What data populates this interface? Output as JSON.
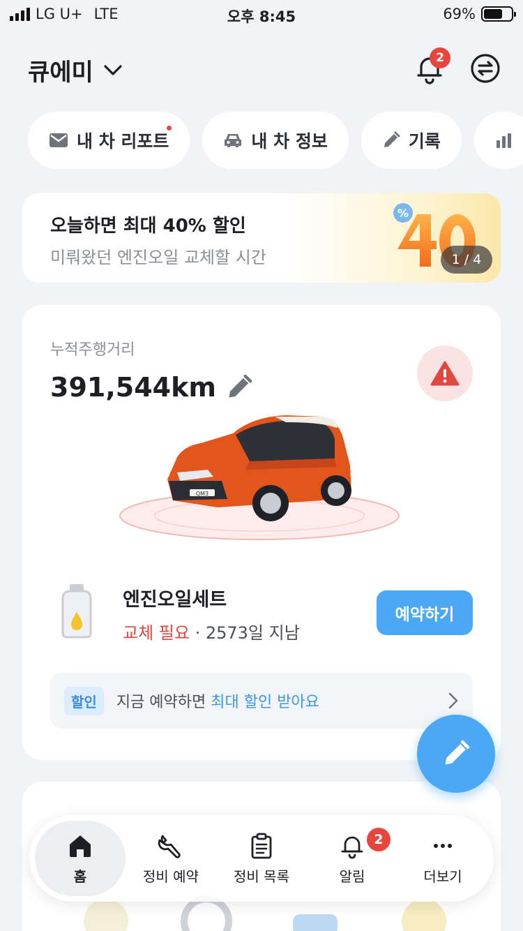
{
  "status_bar": {
    "carrier": "LG U+",
    "network": "LTE",
    "time": "오후 8:45",
    "battery": "69%",
    "battery_level": 0.69
  },
  "header": {
    "car_name": "큐에미",
    "notification_count": "2"
  },
  "chips": [
    {
      "label": "내 차 리포트",
      "icon": "mail-icon",
      "has_dot": true
    },
    {
      "label": "내 차 정보",
      "icon": "car-icon"
    },
    {
      "label": "기록",
      "icon": "pencil-icon"
    },
    {
      "label": "",
      "icon": "bar-chart-icon"
    }
  ],
  "banner": {
    "title": "오늘하면 최대 40% 할인",
    "subtitle": "미뤄왔던 엔진오일 교체할 시간",
    "pager": "1 / 4"
  },
  "vehicle": {
    "odometer_label": "누적주행거리",
    "odometer_value": "391,544km",
    "plate_text": "QM3"
  },
  "maintenance": {
    "item_title": "엔진오일세트",
    "status_need": "교체 필요",
    "status_sep": " · ",
    "status_elapsed": "2573일 지남",
    "reserve_label": "예약하기"
  },
  "discount": {
    "tag": "할인",
    "text_prefix": "지금 예약하면 ",
    "text_highlight": "최대 할인 받아요"
  },
  "tabbar": {
    "items": [
      {
        "label": "홈",
        "icon": "home-icon",
        "active": true
      },
      {
        "label": "정비 예약",
        "icon": "wrench-icon"
      },
      {
        "label": "정비 목록",
        "icon": "clipboard-icon"
      },
      {
        "label": "알림",
        "icon": "bell-icon",
        "badge": "2"
      },
      {
        "label": "더보기",
        "icon": "more-icon"
      }
    ]
  },
  "colors": {
    "accent": "#4aa8f7",
    "alert": "#e8453c",
    "background": "#f2f3f6"
  }
}
